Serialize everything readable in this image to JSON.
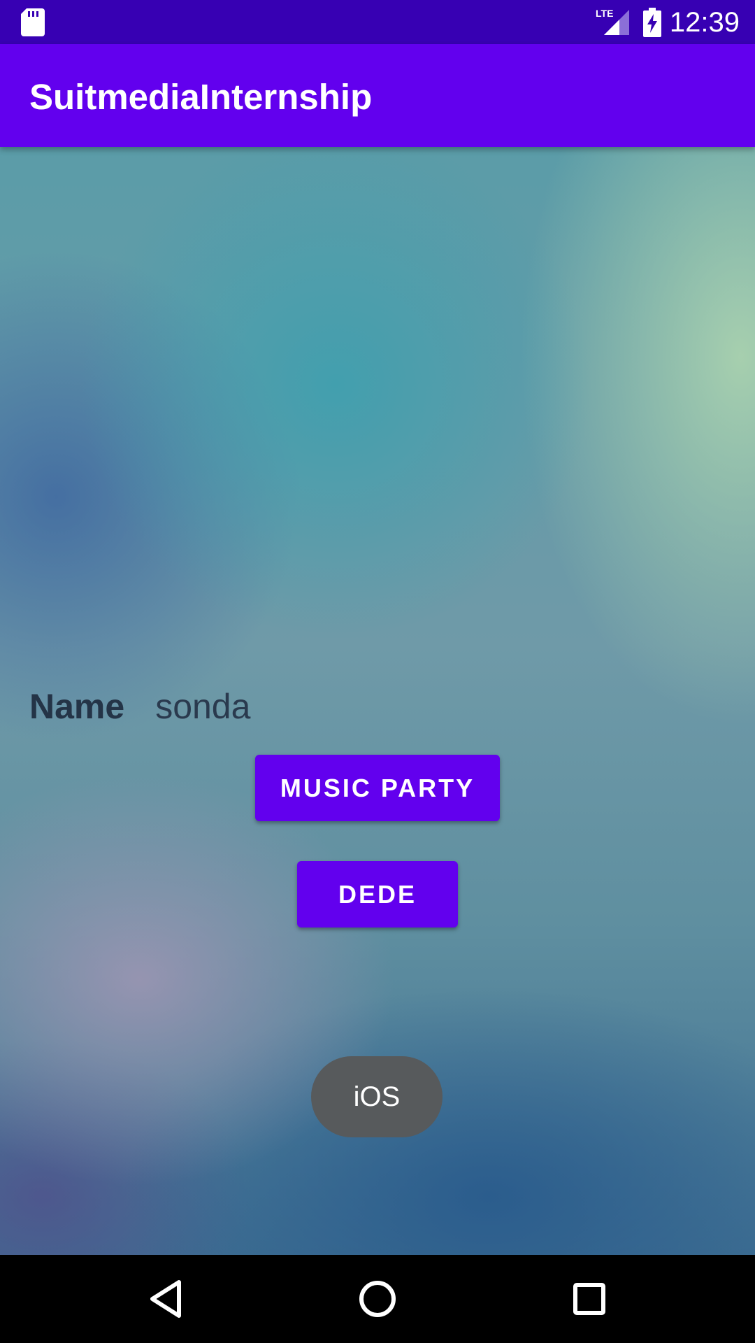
{
  "status_bar": {
    "time": "12:39",
    "network_label": "LTE",
    "icons": [
      "sd-card-icon",
      "lte-signal-icon",
      "battery-charging-icon"
    ]
  },
  "app_bar": {
    "title": "SuitmediaInternship",
    "color": "#6200ee",
    "status_color": "#3700b3"
  },
  "form": {
    "name_label": "Name",
    "name_value": "sonda"
  },
  "buttons": {
    "music_party": "MUSIC PARTY",
    "dede": "DEDE"
  },
  "toast": {
    "text": "iOS"
  },
  "nav_bar": {
    "icons": [
      "back-icon",
      "home-icon",
      "recents-icon"
    ]
  }
}
